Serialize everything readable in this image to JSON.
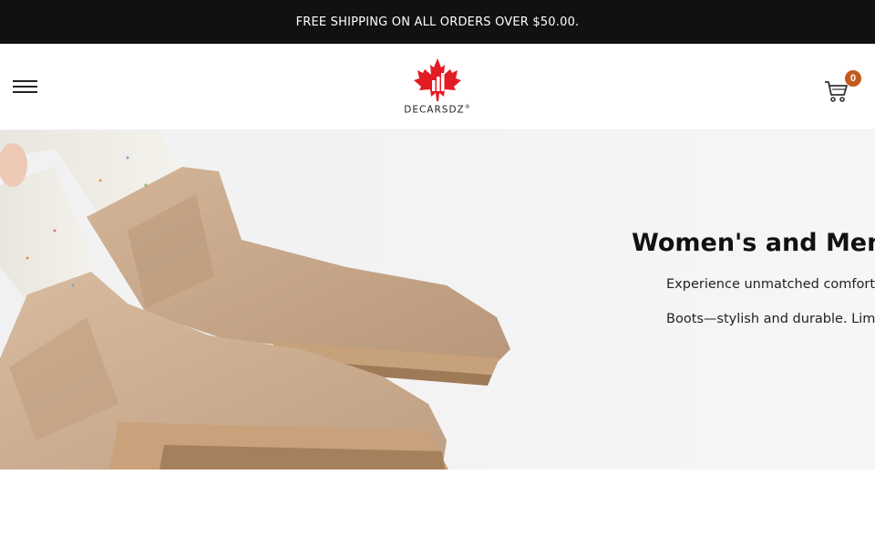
{
  "announcement": {
    "text": "FREE SHIPPING ON ALL ORDERS OVER $50.00."
  },
  "header": {
    "menu_icon": "hamburger-menu-icon",
    "logo": {
      "text": "DECARSDZ",
      "trademark": "®",
      "icon": "maple-leaf-logo"
    },
    "cart": {
      "icon": "shopping-cart-icon",
      "count": "0"
    }
  },
  "hero": {
    "title": "Women's and Men",
    "line1": "Experience unmatched comfort",
    "line2": "Boots—stylish and durable. Limit",
    "image": "beige-suede-chelsea-boots"
  },
  "colors": {
    "announcement_bg": "#111111",
    "logo_red": "#e31b23",
    "badge": "#c45a1e",
    "boot": "#c9a98a"
  }
}
